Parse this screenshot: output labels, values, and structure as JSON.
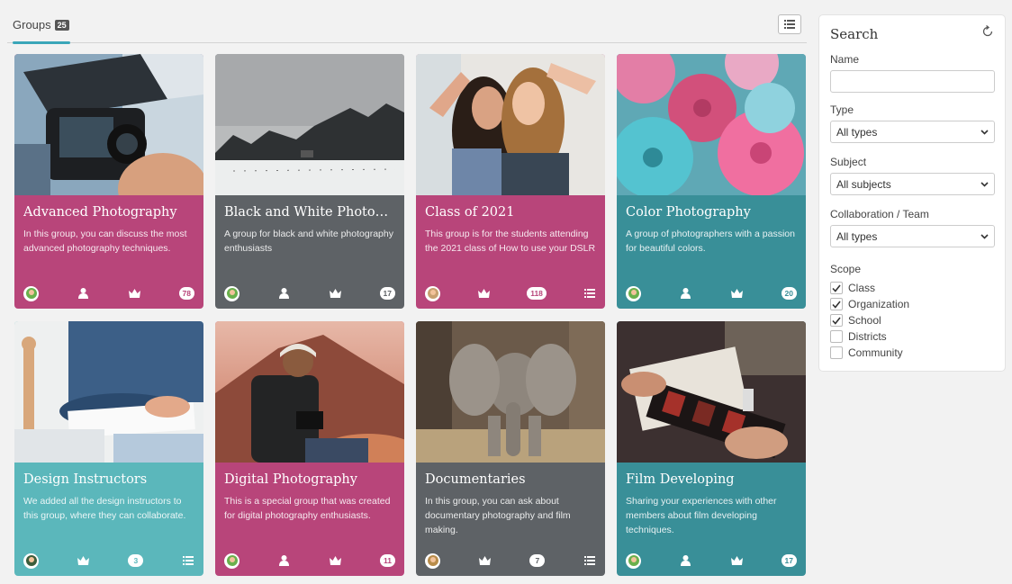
{
  "header": {
    "tab_label": "Groups",
    "tab_count": "25"
  },
  "colors": {
    "pink": "#b8457a",
    "gray": "#5e6266",
    "teal": "#398f98",
    "light_teal": "#5bb7bb",
    "accent": "#3aa6b9"
  },
  "cards": [
    {
      "title": "Advanced Photography",
      "description": "In this group, you can discuss the most advanced photography techniques.",
      "count": "78"
    },
    {
      "title": "Black and White Photogr...",
      "description": "A group for black and white photography enthusiasts",
      "count": "17"
    },
    {
      "title": "Class of 2021",
      "description": "This group is for the students attending the 2021 class of How to use your DSLR",
      "count": "118"
    },
    {
      "title": "Color Photography",
      "description": "A group of photographers with a passion for beautiful colors.",
      "count": "20"
    },
    {
      "title": "Design Instructors",
      "description": "We added all the design instructors to this group, where they can collaborate.",
      "count": "3"
    },
    {
      "title": "Digital Photography",
      "description": "This is a special group that was created for digital photography enthusiasts.",
      "count": "11"
    },
    {
      "title": "Documentaries",
      "description": "In this group, you can ask about documentary photography and film making.",
      "count": "7"
    },
    {
      "title": "Film Developing",
      "description": "Sharing your experiences with other members about film developing techniques.",
      "count": "17"
    }
  ],
  "search": {
    "title": "Search",
    "name_label": "Name",
    "name_value": "",
    "type_label": "Type",
    "type_value": "All types",
    "subject_label": "Subject",
    "subject_value": "All subjects",
    "collab_label": "Collaboration / Team",
    "collab_value": "All types",
    "scope_label": "Scope",
    "scope": [
      {
        "label": "Class",
        "checked": true
      },
      {
        "label": "Organization",
        "checked": true
      },
      {
        "label": "School",
        "checked": true
      },
      {
        "label": "Districts",
        "checked": false
      },
      {
        "label": "Community",
        "checked": false
      }
    ]
  }
}
